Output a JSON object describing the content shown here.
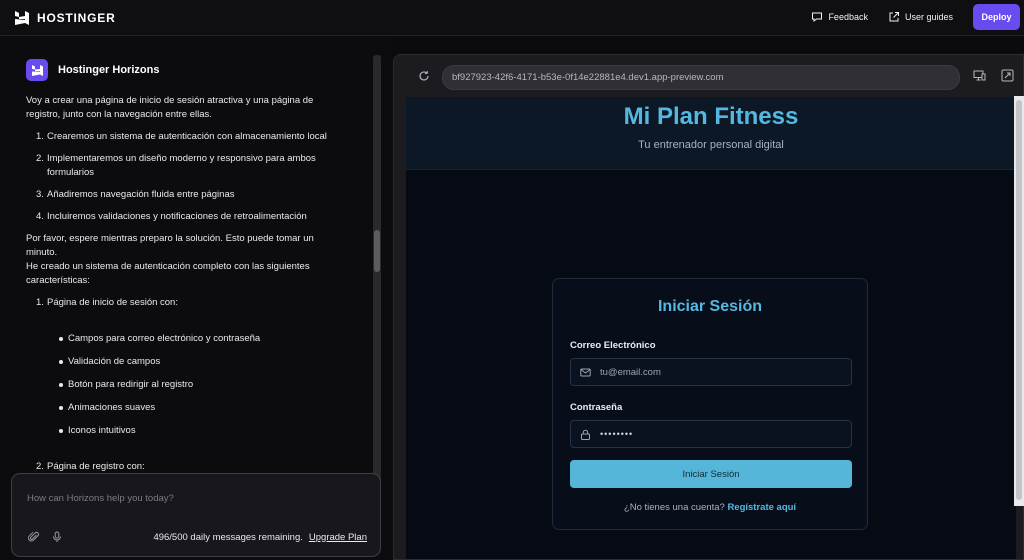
{
  "topbar": {
    "brand_name": "HOSTINGER",
    "feedback_label": "Feedback",
    "guides_label": "User guides",
    "deploy_label": "Deploy",
    "accent_color": "#6a4bf0"
  },
  "chat": {
    "agent_name": "Hostinger Horizons",
    "intro": "Voy a crear una página de inicio de sesión atractiva y una página de registro, junto con la navegación entre ellas.",
    "steps": [
      {
        "num": "1.",
        "text": "Crearemos un sistema de autenticación con almacenamiento local"
      },
      {
        "num": "2.",
        "text": "Implementaremos un diseño moderno y responsivo para ambos formularios"
      },
      {
        "num": "3.",
        "text": "Añadiremos navegación fluida entre páginas"
      },
      {
        "num": "4.",
        "text": "Incluiremos validaciones y notificaciones de retroalimentación"
      }
    ],
    "wait_line1": "Por favor, espere mientras preparo la solución. Esto puede tomar un minuto.",
    "wait_line2": "He creado un sistema de autenticación completo con las siguientes características:",
    "features": [
      {
        "num": "1.",
        "text": "Página de inicio de sesión con:"
      }
    ],
    "sub_bullets": [
      "Campos para correo electrónico y contraseña",
      "Validación de campos",
      "Botón para redirigir al registro",
      "Animaciones suaves",
      "Iconos intuitivos"
    ],
    "next_item": {
      "num": "2.",
      "text": "Página de registro con:"
    },
    "composer_placeholder": "How can Horizons help you today?",
    "remaining_text": "496/500 daily messages remaining.",
    "upgrade_label": "Upgrade Plan"
  },
  "browser": {
    "url": "bf927923-42f6-4171-b53e-0f14e22881e4.dev1.app-preview.com"
  },
  "site": {
    "title": "Mi Plan Fitness",
    "subtitle": "Tu entrenador personal digital",
    "card_title": "Iniciar Sesión",
    "email_label": "Correo Electrónico",
    "email_placeholder": "tu@email.com",
    "password_label": "Contraseña",
    "password_value": "••••••••",
    "login_button": "Iniciar Sesión",
    "signup_prompt": "¿No tienes una cuenta?",
    "signup_link": "Regístrate aquí",
    "accent_color": "#54b8e0"
  }
}
